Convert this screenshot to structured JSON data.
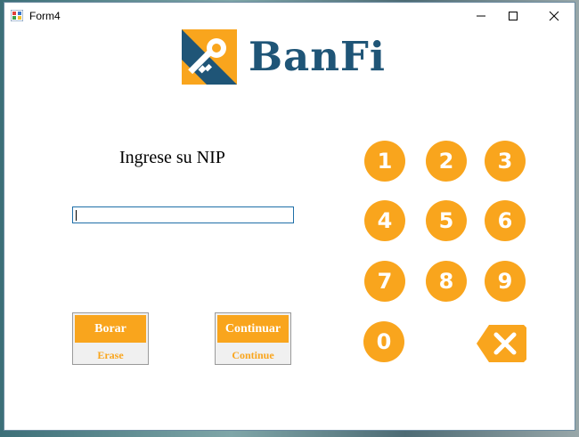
{
  "window": {
    "title": "Form4"
  },
  "brand": {
    "name": "BanFi"
  },
  "colors": {
    "accent": "#f9a51d",
    "brand": "#1f5577"
  },
  "pin": {
    "prompt": "Ingrese su NIP",
    "value": ""
  },
  "actions": {
    "erase": {
      "label": "Borar",
      "sublabel": "Erase"
    },
    "continue": {
      "label": "Continuar",
      "sublabel": "Continue"
    }
  },
  "keypad": {
    "keys": [
      "1",
      "2",
      "3",
      "4",
      "5",
      "6",
      "7",
      "8",
      "9",
      "0"
    ],
    "backspace_icon": "backspace-icon"
  }
}
